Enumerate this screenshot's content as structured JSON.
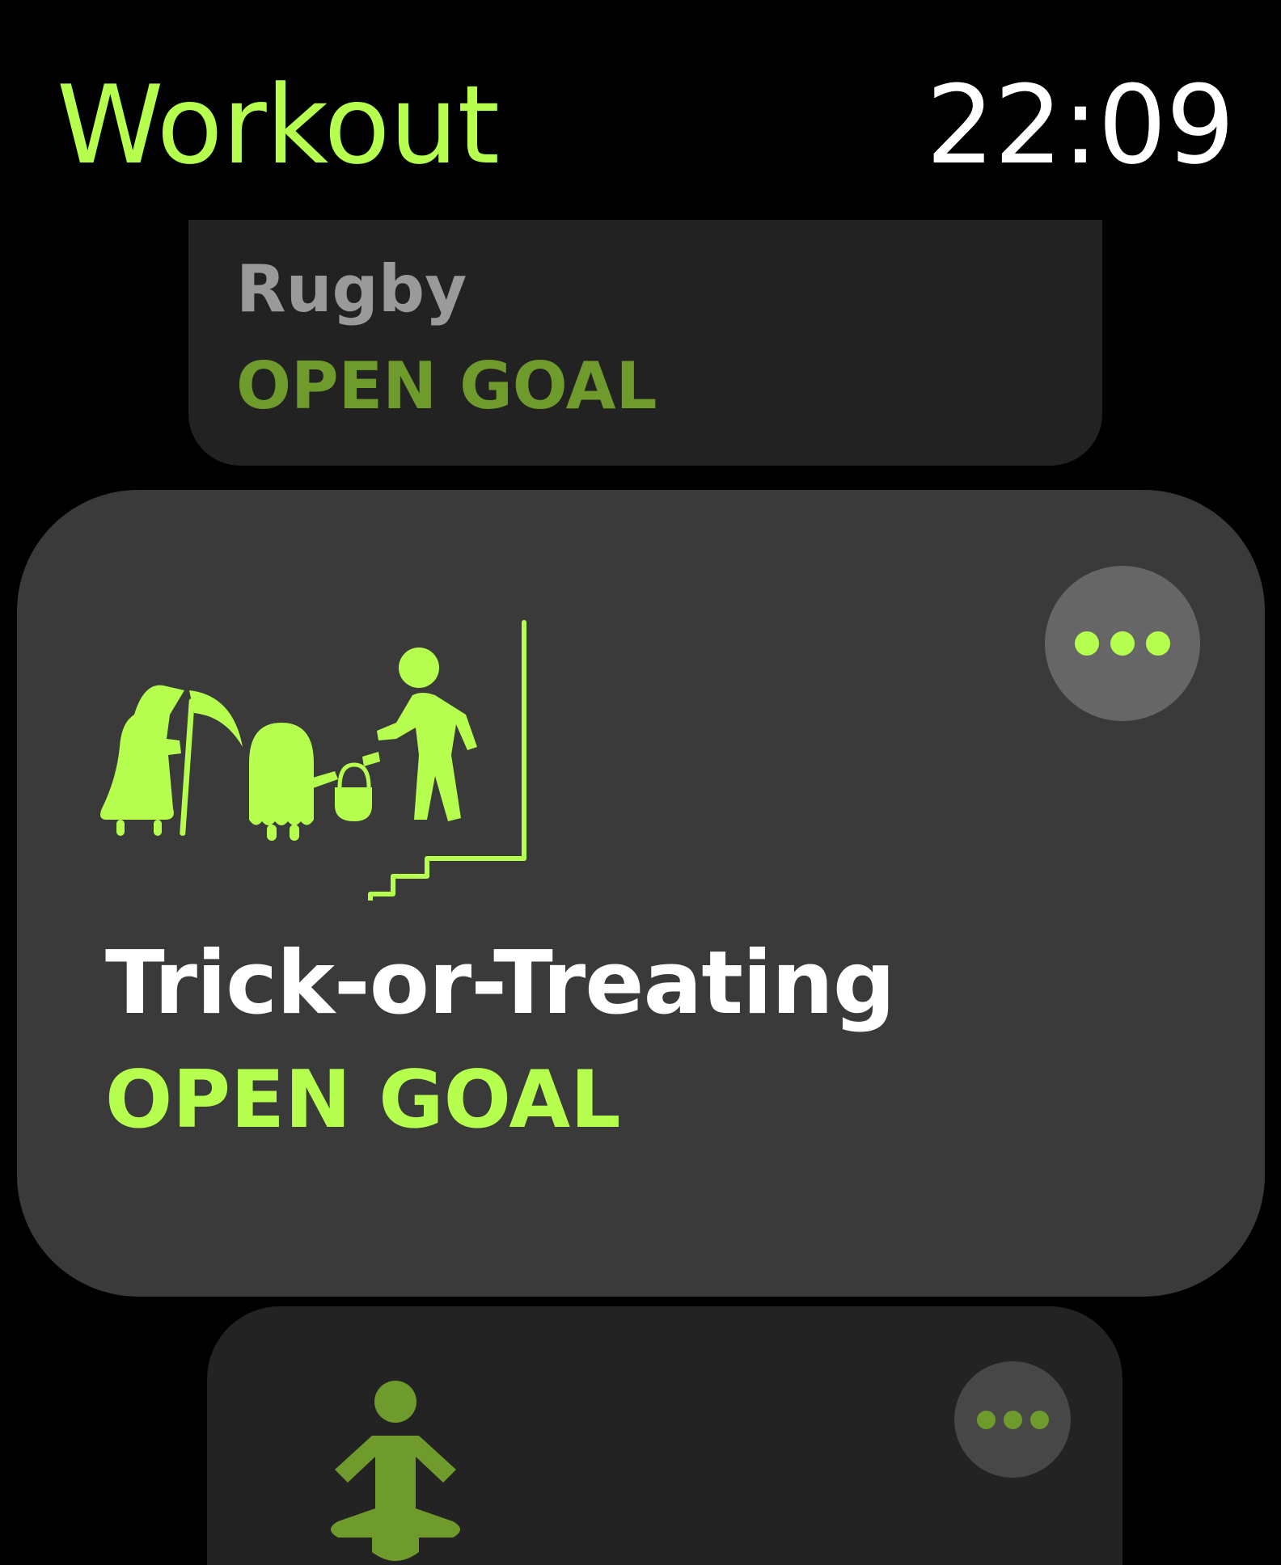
{
  "header": {
    "app_title": "Workout",
    "time": "22:09"
  },
  "workouts": [
    {
      "name": "Rugby",
      "goal": "OPEN GOAL",
      "icon": "rugby-icon"
    },
    {
      "name": "Trick-or-Treating",
      "goal": "OPEN GOAL",
      "icon": "trick-or-treating-icon"
    },
    {
      "name": "",
      "goal": "",
      "icon": "yoga-icon"
    }
  ],
  "colors": {
    "accent": "#b6ff4f",
    "accent_dim": "#6f9a2c",
    "card": "#3a3a3a",
    "card_dim": "#222222"
  },
  "icons": {
    "more": "ellipsis-icon"
  }
}
